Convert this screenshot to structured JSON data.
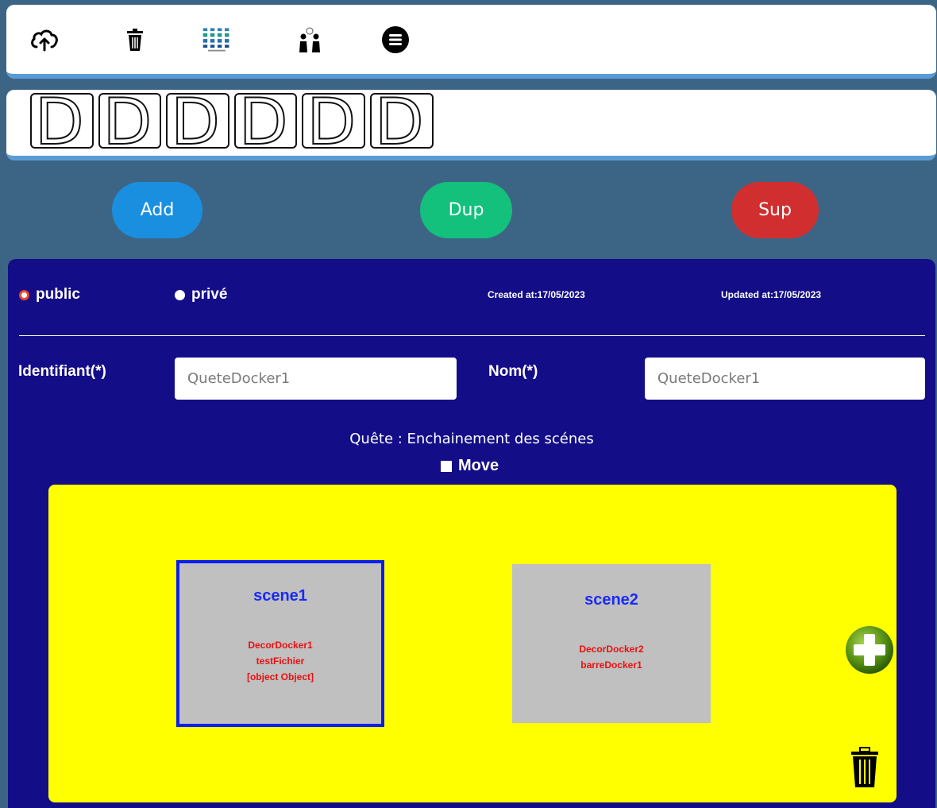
{
  "toolbar": {
    "icons": [
      "cloud-upload-icon",
      "trash-icon",
      "app-logo",
      "people-icon",
      "menu-icon"
    ]
  },
  "banner": {
    "letters": [
      "D",
      "D",
      "D",
      "D",
      "D",
      "D"
    ]
  },
  "actions": {
    "add_label": "Add",
    "dup_label": "Dup",
    "sup_label": "Sup"
  },
  "visibility": {
    "public_label": "public",
    "prive_label": "privé",
    "selected": "public"
  },
  "meta": {
    "created": "Created at:17/05/2023",
    "updated": "Updated at:17/05/2023"
  },
  "form": {
    "identifiant_label": "Identifiant(*)",
    "identifiant_value": "QueteDocker1",
    "nom_label": "Nom(*)",
    "nom_value": "QueteDocker1"
  },
  "quest": {
    "title": "Quête : Enchainement des scénes",
    "move_label": "Move"
  },
  "scenes": [
    {
      "title": "scene1",
      "items": [
        "DecorDocker1",
        "testFichier",
        "[object Object]"
      ]
    },
    {
      "title": "scene2",
      "items": [
        "DecorDocker2",
        "barreDocker1"
      ]
    }
  ],
  "colors": {
    "panel": "#140d88",
    "canvas": "#ffff00",
    "add": "#1a8fe0",
    "dup": "#13c07c",
    "sup": "#d12f2f"
  }
}
